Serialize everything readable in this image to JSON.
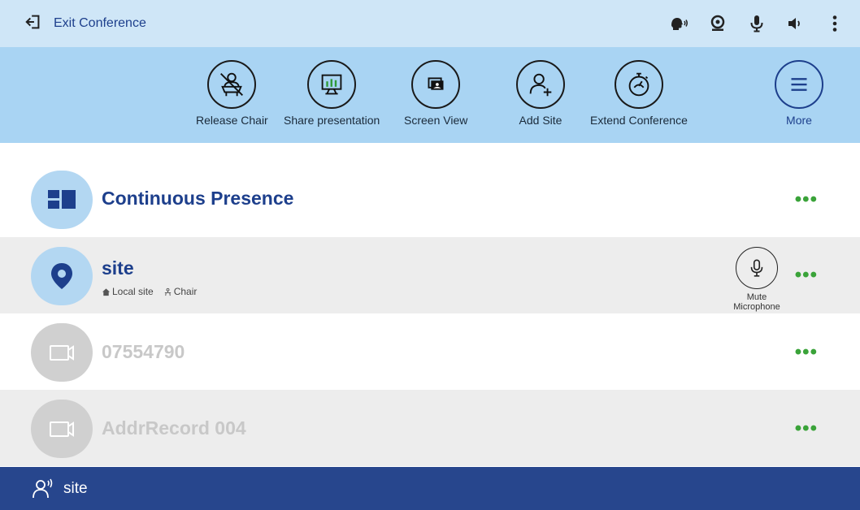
{
  "topbar": {
    "exit_label": "Exit Conference",
    "icons": [
      "speaker-voice-icon",
      "camera-icon",
      "microphone-icon",
      "volume-icon",
      "more-vertical-icon"
    ]
  },
  "toolbar": {
    "release_chair": "Release Chair",
    "share_presentation": "Share presentation",
    "screen_view": "Screen View",
    "add_site": "Add Site",
    "extend_conference": "Extend Conference",
    "more": "More"
  },
  "list": {
    "rows": [
      {
        "title": "Continuous Presence",
        "state": "active",
        "icon": "layout-icon"
      },
      {
        "title": "site",
        "state": "active",
        "icon": "location-pin-icon",
        "tags": [
          "Local site",
          "Chair"
        ],
        "mic_label": "Mute Microphone"
      },
      {
        "title": "07554790",
        "state": "inactive",
        "icon": "video-camera-icon"
      },
      {
        "title": "AddrRecord 004",
        "state": "inactive",
        "icon": "video-camera-icon"
      }
    ],
    "more_glyph": "•••"
  },
  "bottombar": {
    "speaker_label": "site"
  },
  "colors": {
    "topbar_bg": "#cfe6f7",
    "toolbar_bg": "#a9d4f3",
    "accent_blue": "#1d3f8c",
    "bottombar_bg": "#27468d",
    "more_dots": "#3aa339",
    "row_alt_bg": "#ededed"
  }
}
